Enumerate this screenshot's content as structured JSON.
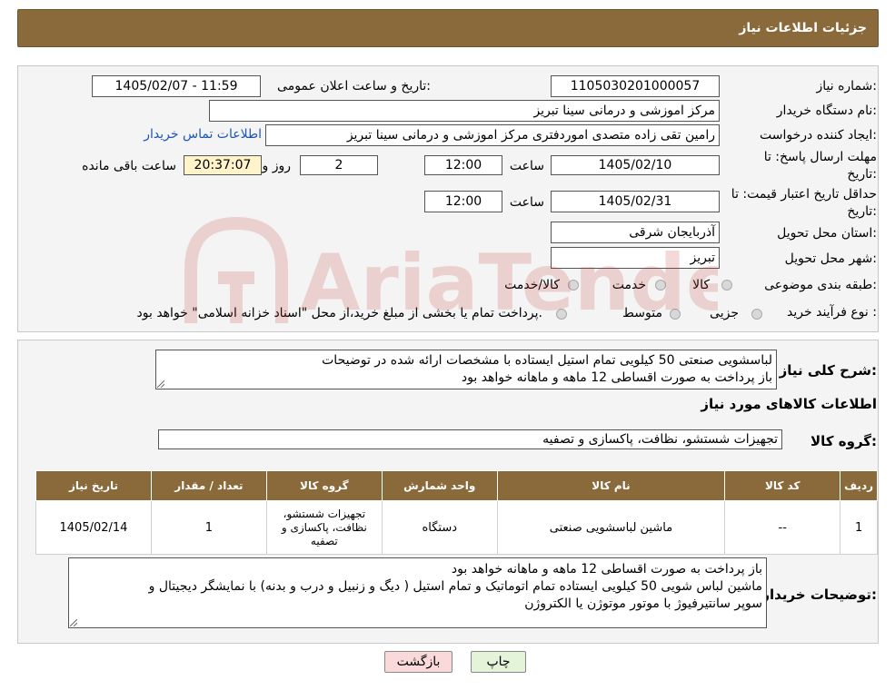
{
  "header": {
    "title": "جزئیات اطلاعات نیاز"
  },
  "form": {
    "need_number_label": "شماره نیاز:",
    "need_number": "1105030201000057",
    "announce_label": "تاریخ و ساعت اعلان عمومی:",
    "announce_value": "1405/02/07 - 11:59",
    "buyer_org_label": "نام دستگاه خریدار:",
    "buyer_org": "مرکز اموزشی و درمانی سینا تبریز",
    "creator_label": "ایجاد کننده درخواست:",
    "creator": "رامین تقی زاده متصدی اموردفتری مرکز اموزشی و درمانی سینا تبریز",
    "contact_link": "اطلاعات تماس خریدار",
    "reply_deadline_label_1": "مهلت ارسال پاسخ: تا",
    "reply_deadline_label_2": "تاریخ:",
    "reply_date": "1405/02/10",
    "time_label": "ساعت",
    "reply_time": "12:00",
    "days_value": "2",
    "days_label": "روز و",
    "remaining_time": "20:37:07",
    "remaining_label": "ساعت باقی مانده",
    "price_validity_label_1": "حداقل تاریخ اعتبار قیمت: تا",
    "price_validity_label_2": "تاریخ:",
    "price_validity_date": "1405/02/31",
    "price_validity_time": "12:00",
    "province_label": "استان محل تحویل:",
    "province": "آذربایجان شرقی",
    "city_label": "شهر محل تحویل:",
    "city": "تبریز",
    "category_label": "طبقه بندی موضوعی:",
    "category_options": [
      "کالا",
      "خدمت",
      "کالا/خدمت"
    ],
    "process_label": "نوع فرآیند خرید :",
    "process_options": [
      "جزیی",
      "متوسط"
    ],
    "process_note": "پرداخت تمام یا بخشی از مبلغ خرید،از محل \"اسناد خزانه اسلامی\" خواهد بود."
  },
  "summary": {
    "label": "شرح کلی نیاز:",
    "line1": "لباسشویی صنعتی 50 کیلویی تمام استیل ایستاده با مشخصات ارائه شده در توضیحات",
    "line2": "باز پرداخت به صورت اقساطی 12 ماهه و ماهانه خواهد بود",
    "goods_info_title": "اطلاعات کالاهای مورد نیاز",
    "group_label": "گروه کالا:",
    "group_value": "تجهیزات شستشو، نظافت، پاکسازی و تصفیه"
  },
  "table": {
    "headers": [
      "ردیف",
      "کد کالا",
      "نام کالا",
      "واحد شمارش",
      "گروه کالا",
      "تعداد / مقدار",
      "تاریخ نیاز"
    ],
    "rows": [
      [
        "1",
        "--",
        "ماشین لباسشویی صنعتی",
        "دستگاه",
        "تجهیزات شستشو، نظافت، پاکسازی و تصفیه",
        "1",
        "1405/02/14"
      ]
    ]
  },
  "notes": {
    "label": "توضیحات خریدار:",
    "line1": "باز پرداخت به صورت اقساطی 12 ماهه و ماهانه خواهد بود",
    "line2": "ماشین لباس شویی 50 کیلویی ایستاده  تمام اتوماتیک و تمام استیل ( دیگ و زنبیل و درب و بدنه) با نمایشگر دیجیتال و",
    "line3": "سوپر سانتیرفیوژ با موتور موتوژن یا الکتروژن"
  },
  "buttons": {
    "print": "چاپ",
    "back": "بازگشت"
  },
  "watermark": {
    "text": "AriaTender.neT",
    "color": "#c0392b"
  },
  "colors": {
    "header_bg": "#8a6a3b",
    "link": "#1a55b5",
    "remaining_bg": "#fff4c9",
    "back_button_bg": "#f9d9d9",
    "print_button_bg": "#e3f4d9"
  }
}
